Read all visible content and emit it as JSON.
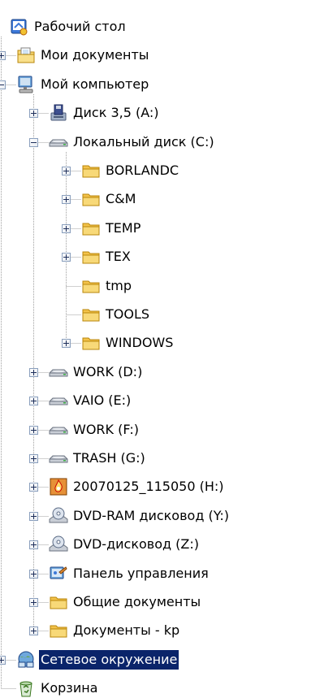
{
  "tree": {
    "selected_color": "#0a246a",
    "nodes": [
      {
        "id": "desktop",
        "label": "Рабочий стол",
        "depth": 0,
        "icon": "desktop-icon",
        "expander": "none"
      },
      {
        "id": "my-documents",
        "label": "Мои документы",
        "depth": 1,
        "icon": "documents-folder-icon",
        "expander": "plus"
      },
      {
        "id": "my-computer",
        "label": "Мой компьютер",
        "depth": 1,
        "icon": "computer-icon",
        "expander": "minus"
      },
      {
        "id": "floppy-a",
        "label": "Диск 3,5 (A:)",
        "depth": 2,
        "icon": "floppy-drive-icon",
        "expander": "plus"
      },
      {
        "id": "local-disk-c",
        "label": "Локальный диск (C:)",
        "depth": 2,
        "icon": "hard-drive-icon",
        "expander": "minus"
      },
      {
        "id": "borlandc",
        "label": "BORLANDC",
        "depth": 3,
        "icon": "folder-icon",
        "expander": "plus"
      },
      {
        "id": "c-and-m",
        "label": "C&M",
        "depth": 3,
        "icon": "folder-icon",
        "expander": "plus"
      },
      {
        "id": "temp",
        "label": "TEMP",
        "depth": 3,
        "icon": "folder-icon",
        "expander": "plus"
      },
      {
        "id": "tex",
        "label": "TEX",
        "depth": 3,
        "icon": "folder-icon",
        "expander": "plus"
      },
      {
        "id": "tmp",
        "label": "tmp",
        "depth": 3,
        "icon": "folder-icon",
        "expander": "none"
      },
      {
        "id": "tools",
        "label": "TOOLS",
        "depth": 3,
        "icon": "folder-icon",
        "expander": "none"
      },
      {
        "id": "windows",
        "label": "WINDOWS",
        "depth": 3,
        "icon": "folder-icon",
        "expander": "plus"
      },
      {
        "id": "work-d",
        "label": "WORK (D:)",
        "depth": 2,
        "icon": "hard-drive-icon",
        "expander": "plus"
      },
      {
        "id": "vaio-e",
        "label": "VAIO (E:)",
        "depth": 2,
        "icon": "hard-drive-icon",
        "expander": "plus"
      },
      {
        "id": "work-f",
        "label": "WORK (F:)",
        "depth": 2,
        "icon": "hard-drive-icon",
        "expander": "plus"
      },
      {
        "id": "trash-g",
        "label": "TRASH (G:)",
        "depth": 2,
        "icon": "hard-drive-icon",
        "expander": "plus"
      },
      {
        "id": "camera-h",
        "label": "20070125_115050 (H:)",
        "depth": 2,
        "icon": "camera-drive-icon",
        "expander": "plus"
      },
      {
        "id": "dvd-ram-y",
        "label": "DVD-RAM дисковод (Y:)",
        "depth": 2,
        "icon": "dvd-drive-icon",
        "expander": "plus"
      },
      {
        "id": "dvd-z",
        "label": "DVD-дисковод (Z:)",
        "depth": 2,
        "icon": "dvd-drive-icon",
        "expander": "plus"
      },
      {
        "id": "control-panel",
        "label": "Панель управления",
        "depth": 2,
        "icon": "control-panel-icon",
        "expander": "plus"
      },
      {
        "id": "shared-documents",
        "label": "Общие документы",
        "depth": 2,
        "icon": "folder-icon",
        "expander": "plus"
      },
      {
        "id": "documents-kp",
        "label": "Документы - kp",
        "depth": 2,
        "icon": "folder-icon",
        "expander": "plus"
      },
      {
        "id": "network",
        "label": "Сетевое окружение",
        "depth": 1,
        "icon": "network-places-icon",
        "expander": "plus",
        "selected": true
      },
      {
        "id": "recycle-bin",
        "label": "Корзина",
        "depth": 1,
        "icon": "recycle-bin-icon",
        "expander": "none"
      }
    ]
  }
}
